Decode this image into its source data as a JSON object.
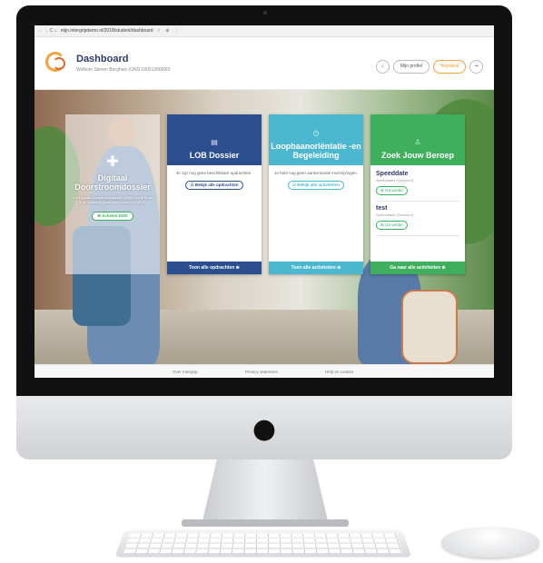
{
  "browser": {
    "url": "mijn.intergripdemo.nl/2018/student/dashboard",
    "nav_icons": "← → C ⌂",
    "right_icons": "☆ ⊕ ⋮"
  },
  "header": {
    "title": "Dashboard",
    "subtitle": "Welkom Steven Berghuis (ONS 19001390000)",
    "home_icon": "⌂",
    "profile_label": "Mijn profiel",
    "helpdesk_label": "Helpdesk",
    "logout_icon": "⇥"
  },
  "cards": {
    "dd": {
      "plus": "✚",
      "title": "Digitaal Doorstroomdossier",
      "text": "Het Digitaal Doorstroomdossier (DDD) vul je in als je de overstap gaat maken naar het MBO.",
      "button": "⊕ Activeer DDD"
    },
    "lob": {
      "icon": "▤",
      "title": "LOB Dossier",
      "text": "Er zijn nog geen beschikbare opdrachten.",
      "button": "☷ Bekijk alle opdrachten",
      "footer": "Toon alle opdrachten ⊕"
    },
    "loopbaan": {
      "icon": "◷",
      "title": "Loopbaanoriëntatie -en Begeleiding",
      "text": "Je hebt nog geen aankomende inschrijvingen.",
      "button": "☷ Bekijk alle activiteiten",
      "footer": "Toon alle activiteiten ⊕"
    },
    "beroep": {
      "icon": "♙",
      "title": "Zoek Jouw Beroep",
      "items": [
        {
          "title": "Speeddate",
          "sub": "Speeddates (Gesloten)",
          "button": "⊕ Ga verder"
        },
        {
          "title": "test",
          "sub": "Speeddates (Gesloten)",
          "button": "⊕ Ga verder"
        }
      ],
      "footer": "Ga naar alle activiteiten ⊕"
    }
  },
  "footer": {
    "about": "Over Intergrip",
    "privacy": "Privacy statement",
    "help": "Help en contact"
  },
  "colors": {
    "lob": "#2b4e8f",
    "loopbaan": "#4cb8cf",
    "beroep": "#3fae5d",
    "accent": "#f4a23a"
  }
}
